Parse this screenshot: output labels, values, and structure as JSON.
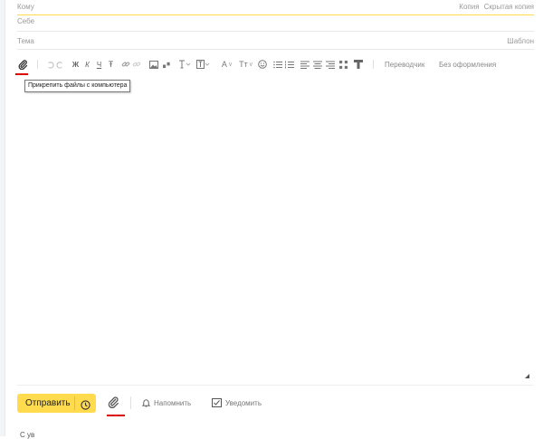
{
  "compose": {
    "to_label": "Кому",
    "cc_label": "Копия",
    "bcc_label": "Скрытая копия",
    "self_label": "Себе",
    "subject_label": "Тема",
    "template_label": "Шаблон"
  },
  "toolbar": {
    "bold": "Ж",
    "italic": "К",
    "underline": "Ч",
    "strike": "Ŧ",
    "text_color": "A",
    "font_size": "Tт",
    "translator": "Переводчик",
    "no_format": "Без оформления"
  },
  "tooltip": {
    "attach": "Прикрепить файлы с компьютера"
  },
  "footer": {
    "send": "Отправить",
    "remind": "Напомнить",
    "notify": "Уведомить",
    "hint": "С ув"
  },
  "colors": {
    "accent": "#ffdb4d",
    "highlight": "#dd0000"
  }
}
